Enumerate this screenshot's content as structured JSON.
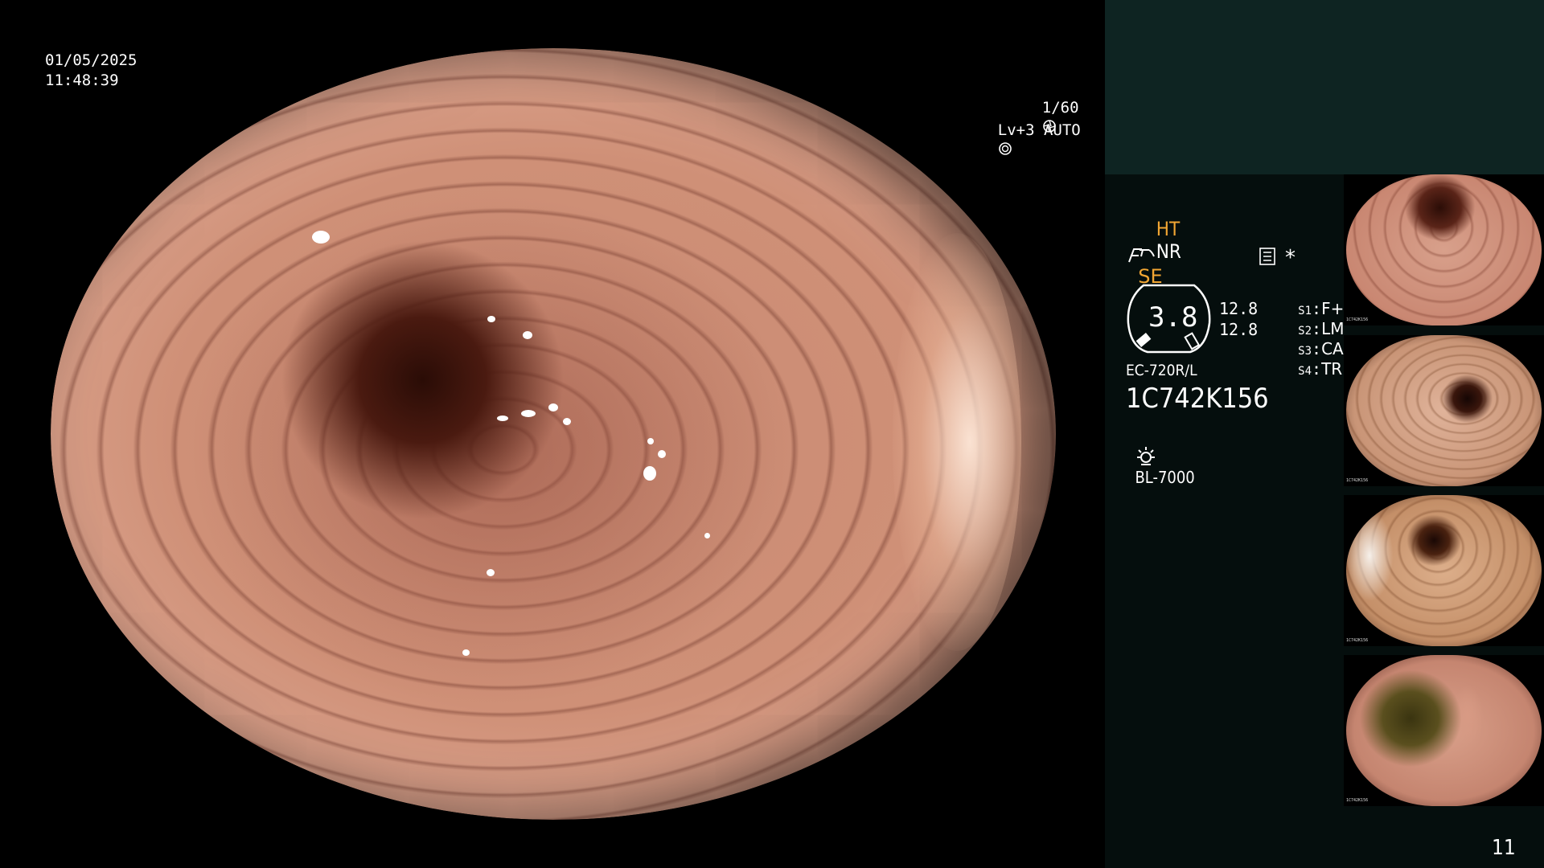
{
  "overlay": {
    "date": "01/05/2025",
    "time": "11:48:39",
    "shutter": "1/60",
    "level": "Lv+3 AUTO"
  },
  "panel": {
    "ht": "HT",
    "nr": "NR",
    "se": "SE",
    "star": "*",
    "gauge_value": "3.8",
    "readout_top": "12.8",
    "readout_bottom": "12.8",
    "settings": [
      {
        "key": "S1",
        "value": "F+T"
      },
      {
        "key": "S2",
        "value": "LM"
      },
      {
        "key": "S3",
        "value": "CAD"
      },
      {
        "key": "S4",
        "value": "TRIG"
      }
    ],
    "scope_model": "EC-720R/L",
    "serial": "1C742K156",
    "light_source": "BL-7000",
    "page_number": "11"
  },
  "thumbnails": [
    {
      "label": "1C742K156"
    },
    {
      "label": "1C742K156"
    },
    {
      "label": "1C742K156"
    },
    {
      "label": "1C742K156"
    }
  ],
  "icons": {
    "shutter": "shutter-icon",
    "auto": "iris-icon",
    "enhance": "structure-enhance-icon",
    "freeze": "freeze-icon",
    "record": "record-icon",
    "lamp": "lamp-icon"
  },
  "colors": {
    "accent": "#f2a633",
    "panel_top": "#0e2422",
    "panel": "#050e0d"
  }
}
